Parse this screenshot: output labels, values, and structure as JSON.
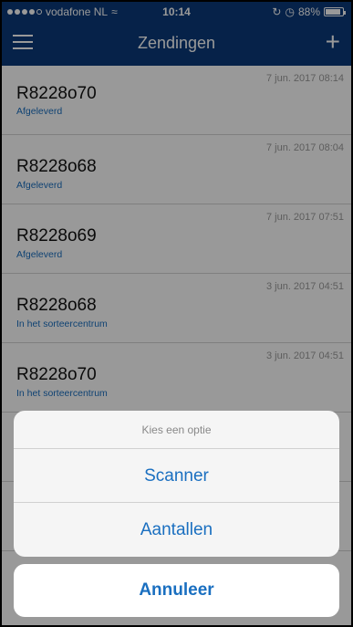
{
  "status_bar": {
    "carrier": "vodafone NL",
    "time": "10:14",
    "battery": "88%"
  },
  "nav": {
    "title": "Zendingen",
    "menu_icon": "hamburger-menu-icon",
    "add_icon": "plus-icon",
    "add_label": "+"
  },
  "shipments": [
    {
      "code": "R8228o70",
      "status": "Afgeleverd",
      "date": "7 jun. 2017 08:14"
    },
    {
      "code": "R8228o68",
      "status": "Afgeleverd",
      "date": "7 jun. 2017 08:04"
    },
    {
      "code": "R8228o69",
      "status": "Afgeleverd",
      "date": "7 jun. 2017 07:51"
    },
    {
      "code": "R8228o68",
      "status": "In het sorteercentrum",
      "date": "3 jun. 2017 04:51"
    },
    {
      "code": "R8228o70",
      "status": "In het sorteercentrum",
      "date": "3 jun. 2017 04:51"
    }
  ],
  "action_sheet": {
    "title": "Kies een optie",
    "options": [
      "Scanner",
      "Aantallen"
    ],
    "cancel": "Annuleer"
  },
  "colors": {
    "nav_background": "#0b3a7a",
    "accent": "#1a6fc0"
  }
}
